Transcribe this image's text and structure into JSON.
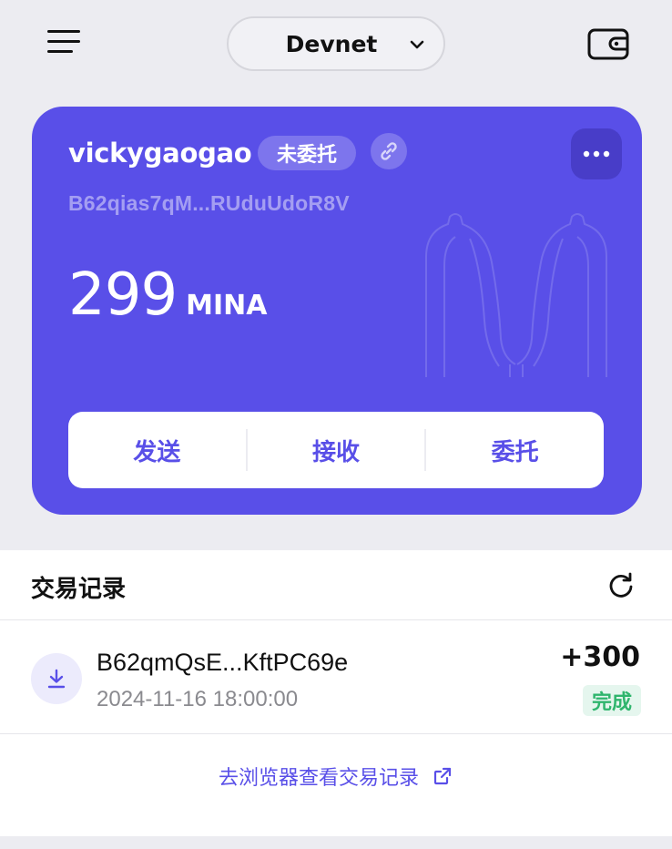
{
  "header": {
    "network": "Devnet",
    "menu_icon": "hamburger-menu-icon",
    "wallet_icon": "wallet-icon"
  },
  "account": {
    "name": "vickygaogao",
    "status": "未委托",
    "address": "B62qias7qM...RUduUdoR8V",
    "balance": "299",
    "unit": "MINA",
    "card_color": "#594fe8"
  },
  "actions": {
    "send": "发送",
    "receive": "接收",
    "delegate": "委托"
  },
  "transactions": {
    "title": "交易记录",
    "items": [
      {
        "address": "B62qmQsE...KftPC69e",
        "time": "2024-11-16 18:00:00",
        "amount": "+300",
        "status": "完成",
        "icon": "download-icon"
      }
    ],
    "explorer_link": "去浏览器查看交易记录"
  }
}
